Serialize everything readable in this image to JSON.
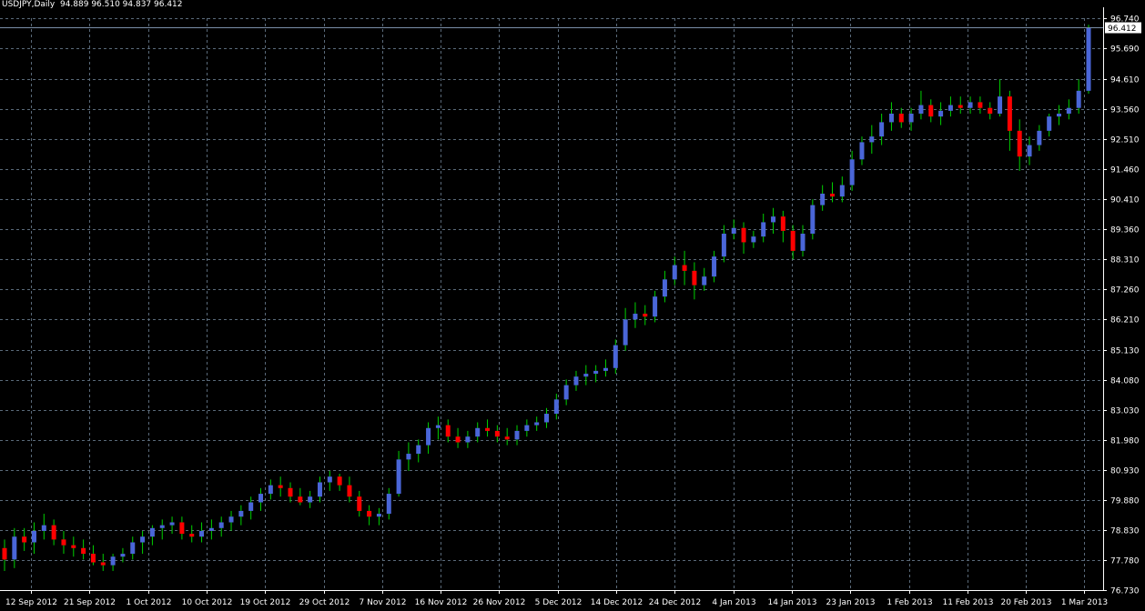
{
  "window": {
    "header_text": "USDJPY,Daily  94.889 96.510 94.837 96.412"
  },
  "colors": {
    "background": "#000000",
    "grid": "#5a6a7a",
    "axis": "#ffffff",
    "bull_body": "#4a66d8",
    "bear_body": "#ff0000",
    "wick": "#00d000",
    "price_line": "#7a8ea8",
    "label_bg": "#ffffff",
    "label_text": "#000000"
  },
  "chart_data": {
    "type": "candlestick",
    "symbol": "USDJPY",
    "timeframe": "Daily",
    "last_price": "96.412",
    "ylim": [
      76.73,
      96.74
    ],
    "y_ticks": [
      "96.740",
      "95.690",
      "94.610",
      "93.560",
      "92.510",
      "91.460",
      "90.410",
      "89.360",
      "88.310",
      "87.260",
      "86.210",
      "85.130",
      "84.080",
      "83.030",
      "81.980",
      "80.930",
      "79.880",
      "78.830",
      "77.780",
      "76.730"
    ],
    "x_ticks": [
      "12 Sep 2012",
      "21 Sep 2012",
      "1 Oct 2012",
      "10 Oct 2012",
      "19 Oct 2012",
      "29 Oct 2012",
      "7 Nov 2012",
      "16 Nov 2012",
      "26 Nov 2012",
      "5 Dec 2012",
      "14 Dec 2012",
      "24 Dec 2012",
      "4 Jan 2013",
      "14 Jan 2013",
      "23 Jan 2013",
      "1 Feb 2013",
      "11 Feb 2013",
      "20 Feb 2013",
      "1 Mar 2013"
    ],
    "ohlc": [
      [
        78.2,
        78.5,
        77.4,
        77.8
      ],
      [
        77.8,
        78.9,
        77.5,
        78.6
      ],
      [
        78.6,
        78.9,
        78.1,
        78.4
      ],
      [
        78.4,
        79.1,
        78.0,
        78.8
      ],
      [
        78.8,
        79.4,
        78.5,
        79.0
      ],
      [
        79.0,
        79.2,
        78.3,
        78.5
      ],
      [
        78.5,
        78.8,
        78.0,
        78.3
      ],
      [
        78.3,
        78.6,
        77.9,
        78.2
      ],
      [
        78.2,
        78.5,
        77.8,
        78.0
      ],
      [
        78.0,
        78.3,
        77.6,
        77.7
      ],
      [
        77.7,
        78.0,
        77.4,
        77.6
      ],
      [
        77.6,
        78.0,
        77.4,
        77.9
      ],
      [
        77.9,
        78.2,
        77.7,
        78.0
      ],
      [
        78.0,
        78.6,
        77.8,
        78.4
      ],
      [
        78.4,
        78.8,
        78.0,
        78.6
      ],
      [
        78.6,
        79.0,
        78.3,
        78.9
      ],
      [
        78.9,
        79.2,
        78.5,
        79.0
      ],
      [
        79.0,
        79.3,
        78.7,
        79.1
      ],
      [
        79.1,
        79.3,
        78.5,
        78.7
      ],
      [
        78.7,
        79.0,
        78.4,
        78.6
      ],
      [
        78.6,
        79.1,
        78.4,
        78.8
      ],
      [
        78.8,
        79.2,
        78.5,
        78.9
      ],
      [
        78.9,
        79.3,
        78.6,
        79.1
      ],
      [
        79.1,
        79.5,
        78.8,
        79.3
      ],
      [
        79.3,
        79.7,
        79.0,
        79.5
      ],
      [
        79.5,
        80.0,
        79.2,
        79.8
      ],
      [
        79.8,
        80.3,
        79.5,
        80.1
      ],
      [
        80.1,
        80.6,
        79.9,
        80.4
      ],
      [
        80.4,
        80.7,
        80.0,
        80.3
      ],
      [
        80.3,
        80.5,
        79.8,
        80.0
      ],
      [
        80.0,
        80.3,
        79.7,
        79.8
      ],
      [
        79.8,
        80.2,
        79.6,
        80.0
      ],
      [
        80.0,
        80.7,
        79.8,
        80.5
      ],
      [
        80.5,
        80.9,
        80.2,
        80.7
      ],
      [
        80.7,
        80.8,
        80.2,
        80.4
      ],
      [
        80.4,
        80.7,
        79.8,
        80.0
      ],
      [
        80.0,
        80.2,
        79.3,
        79.5
      ],
      [
        79.5,
        79.7,
        79.0,
        79.3
      ],
      [
        79.3,
        79.6,
        79.0,
        79.4
      ],
      [
        79.4,
        80.3,
        79.2,
        80.1
      ],
      [
        80.1,
        81.6,
        80.0,
        81.3
      ],
      [
        81.3,
        81.9,
        80.9,
        81.5
      ],
      [
        81.5,
        82.0,
        81.2,
        81.8
      ],
      [
        81.8,
        82.6,
        81.5,
        82.4
      ],
      [
        82.4,
        82.8,
        82.0,
        82.5
      ],
      [
        82.5,
        82.7,
        81.9,
        82.1
      ],
      [
        82.1,
        82.4,
        81.7,
        81.9
      ],
      [
        81.9,
        82.3,
        81.7,
        82.1
      ],
      [
        82.1,
        82.6,
        81.9,
        82.4
      ],
      [
        82.4,
        82.7,
        82.1,
        82.3
      ],
      [
        82.3,
        82.5,
        81.9,
        82.1
      ],
      [
        82.1,
        82.4,
        81.8,
        82.0
      ],
      [
        82.0,
        82.5,
        81.8,
        82.3
      ],
      [
        82.3,
        82.7,
        82.1,
        82.5
      ],
      [
        82.5,
        82.8,
        82.3,
        82.6
      ],
      [
        82.6,
        83.1,
        82.4,
        82.9
      ],
      [
        82.9,
        83.6,
        82.7,
        83.4
      ],
      [
        83.4,
        84.1,
        83.2,
        83.9
      ],
      [
        83.9,
        84.4,
        83.7,
        84.2
      ],
      [
        84.2,
        84.6,
        83.9,
        84.3
      ],
      [
        84.3,
        84.6,
        84.0,
        84.4
      ],
      [
        84.4,
        84.8,
        84.2,
        84.5
      ],
      [
        84.5,
        85.5,
        84.3,
        85.3
      ],
      [
        85.3,
        86.6,
        85.1,
        86.2
      ],
      [
        86.2,
        86.8,
        85.9,
        86.4
      ],
      [
        86.4,
        86.7,
        86.0,
        86.3
      ],
      [
        86.3,
        87.2,
        86.1,
        87.0
      ],
      [
        87.0,
        87.9,
        86.8,
        87.6
      ],
      [
        87.6,
        88.4,
        87.4,
        88.1
      ],
      [
        88.1,
        88.6,
        87.4,
        87.9
      ],
      [
        87.9,
        88.2,
        86.9,
        87.4
      ],
      [
        87.4,
        88.0,
        87.2,
        87.7
      ],
      [
        87.7,
        88.6,
        87.5,
        88.4
      ],
      [
        88.4,
        89.5,
        88.2,
        89.2
      ],
      [
        89.2,
        89.7,
        89.0,
        89.4
      ],
      [
        89.4,
        89.6,
        88.5,
        88.9
      ],
      [
        88.9,
        89.3,
        88.7,
        89.1
      ],
      [
        89.1,
        89.9,
        88.9,
        89.6
      ],
      [
        89.6,
        90.1,
        89.2,
        89.8
      ],
      [
        89.8,
        90.0,
        88.9,
        89.3
      ],
      [
        89.3,
        89.5,
        88.3,
        88.6
      ],
      [
        88.6,
        89.5,
        88.4,
        89.2
      ],
      [
        89.2,
        90.4,
        89.0,
        90.2
      ],
      [
        90.2,
        90.9,
        90.0,
        90.6
      ],
      [
        90.6,
        91.0,
        90.3,
        90.5
      ],
      [
        90.5,
        91.2,
        90.3,
        90.9
      ],
      [
        90.9,
        92.1,
        90.7,
        91.8
      ],
      [
        91.8,
        92.6,
        91.6,
        92.4
      ],
      [
        92.4,
        93.0,
        92.0,
        92.6
      ],
      [
        92.6,
        93.4,
        92.3,
        93.1
      ],
      [
        93.1,
        93.8,
        92.8,
        93.4
      ],
      [
        93.4,
        93.6,
        92.9,
        93.1
      ],
      [
        93.1,
        93.6,
        92.8,
        93.4
      ],
      [
        93.4,
        94.2,
        93.2,
        93.7
      ],
      [
        93.7,
        93.9,
        93.1,
        93.3
      ],
      [
        93.3,
        93.8,
        93.0,
        93.5
      ],
      [
        93.5,
        94.0,
        93.3,
        93.7
      ],
      [
        93.7,
        94.0,
        93.4,
        93.6
      ],
      [
        93.6,
        94.0,
        93.4,
        93.8
      ],
      [
        93.8,
        94.0,
        93.4,
        93.6
      ],
      [
        93.6,
        93.8,
        93.2,
        93.4
      ],
      [
        93.4,
        94.6,
        93.3,
        94.0
      ],
      [
        94.0,
        94.2,
        92.1,
        92.8
      ],
      [
        92.8,
        93.2,
        91.4,
        91.9
      ],
      [
        91.9,
        92.6,
        91.6,
        92.3
      ],
      [
        92.3,
        93.0,
        92.1,
        92.8
      ],
      [
        92.8,
        93.4,
        92.6,
        93.3
      ],
      [
        93.3,
        93.7,
        93.0,
        93.4
      ],
      [
        93.4,
        93.9,
        93.2,
        93.6
      ],
      [
        93.6,
        94.6,
        93.4,
        94.2
      ],
      [
        94.2,
        96.51,
        94.1,
        96.41
      ]
    ]
  }
}
